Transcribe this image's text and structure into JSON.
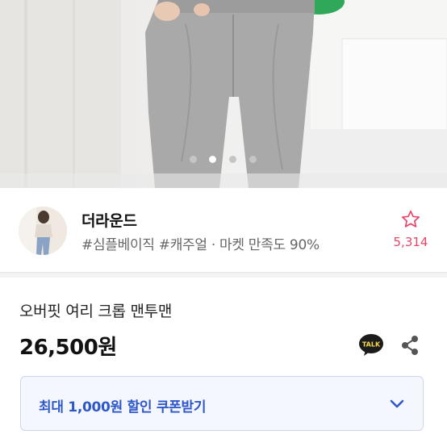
{
  "carousel": {
    "slide_count": 4,
    "active_index": 1
  },
  "shop": {
    "name": "더라운드",
    "tags": "#심플베이직 #캐주얼 · 마켓 만족도 90%",
    "favorite_count": "5,314",
    "favorite_color": "#e8476a",
    "avatar_icon": "shop-avatar"
  },
  "product": {
    "name": "오버핏 여리 크롭 맨투맨",
    "price": "26,500원"
  },
  "actions": {
    "talk_label": "TALK",
    "talk_icon": "kakaotalk-icon",
    "share_icon": "share-icon"
  },
  "coupon": {
    "label": "최대 1,000원 할인 쿠폰받기",
    "accent": "#2e57c9",
    "icon": "chevron-down-icon"
  }
}
